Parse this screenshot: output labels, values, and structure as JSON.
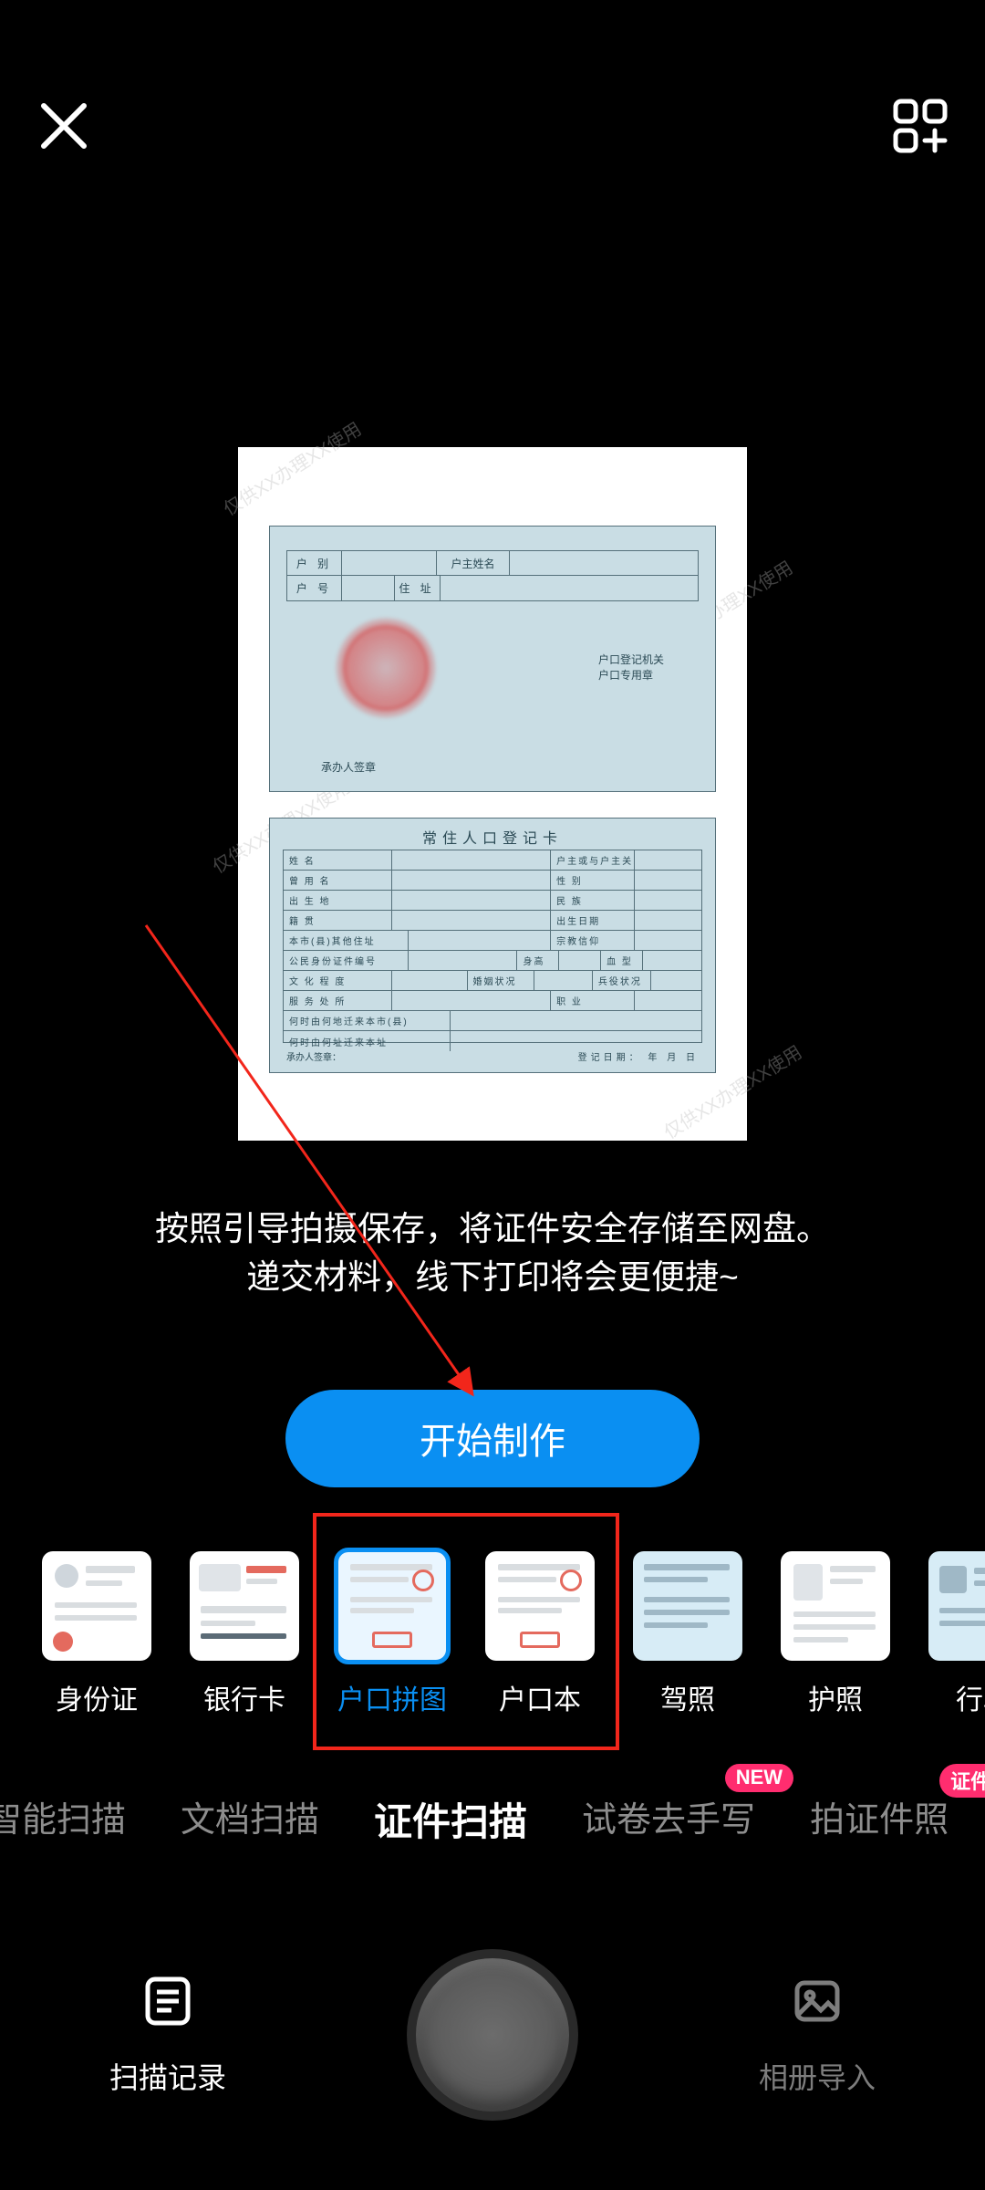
{
  "header": {
    "close": "close",
    "grid": "grid-add"
  },
  "preview": {
    "top_card": {
      "r1c1": "户 别",
      "r1c3": "户主姓名",
      "r2c1": "户 号",
      "r2c3": "住 址",
      "right_line1": "户口登记机关",
      "right_line2": "户口专用章",
      "sign": "承办人签章"
    },
    "bottom_card": {
      "title": "常住人口登记卡",
      "rows": [
        [
          "姓 名",
          "",
          "户主或与户主关系",
          ""
        ],
        [
          "曾 用 名",
          "",
          "性 别",
          ""
        ],
        [
          "出 生 地",
          "",
          "民 族",
          ""
        ],
        [
          "籍 贯",
          "",
          "出生日期",
          ""
        ],
        [
          "本市(县)其他住址",
          "",
          "宗教信仰",
          ""
        ],
        [
          "公民身份证件编号",
          "",
          "身高",
          "",
          "血 型",
          ""
        ],
        [
          "文 化 程 度",
          "",
          "婚姻状况",
          "",
          "兵役状况",
          ""
        ],
        [
          "服 务 处 所",
          "",
          "职 业",
          ""
        ],
        [
          "何时由何地迁来本市(县)",
          "",
          "",
          ""
        ],
        [
          "何时由何址迁来本址",
          "",
          "",
          ""
        ]
      ],
      "foot_left": "承办人签章：",
      "foot_right": "登记日期：    年    月    日"
    },
    "watermark": "仅供XX办理XX使用"
  },
  "hint_line1": "按照引导拍摄保存，将证件安全存储至网盘。",
  "hint_line2": "递交材料，线下打印将会更便捷~",
  "start_button": "开始制作",
  "doc_types": [
    {
      "id": "idcard",
      "label": "身份证",
      "active": false
    },
    {
      "id": "bankcard",
      "label": "银行卡",
      "active": false
    },
    {
      "id": "hukou-collage",
      "label": "户口拼图",
      "active": true
    },
    {
      "id": "hukou",
      "label": "户口本",
      "active": false
    },
    {
      "id": "driver",
      "label": "驾照",
      "active": false
    },
    {
      "id": "passport",
      "label": "护照",
      "active": false
    },
    {
      "id": "vehicle",
      "label": "行驶",
      "active": false
    }
  ],
  "modes": [
    {
      "id": "smart",
      "label": "智能扫描",
      "active": false,
      "badge": null
    },
    {
      "id": "doc",
      "label": "文档扫描",
      "active": false,
      "badge": null
    },
    {
      "id": "cert",
      "label": "证件扫描",
      "active": true,
      "badge": null
    },
    {
      "id": "exam",
      "label": "试卷去手写",
      "active": false,
      "badge": "NEW"
    },
    {
      "id": "photo",
      "label": "拍证件照",
      "active": false,
      "badge": "证件"
    }
  ],
  "bottom": {
    "history": "扫描记录",
    "import": "相册导入"
  }
}
